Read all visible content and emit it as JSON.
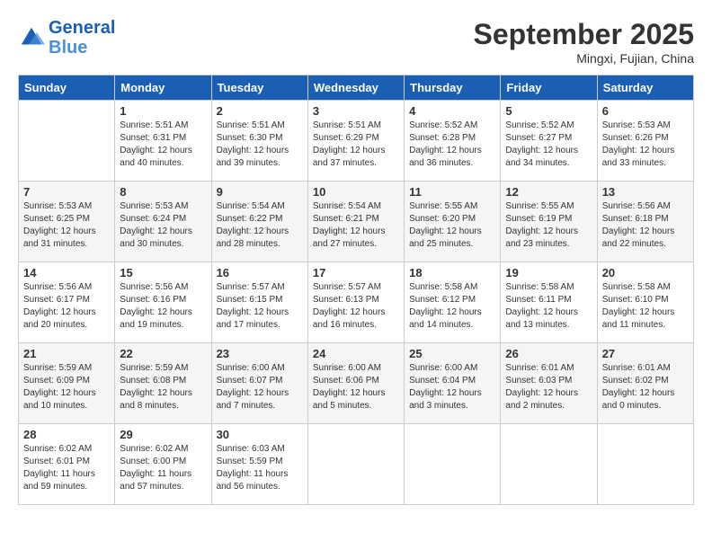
{
  "header": {
    "logo_line1": "General",
    "logo_line2": "Blue",
    "month": "September 2025",
    "location": "Mingxi, Fujian, China"
  },
  "weekdays": [
    "Sunday",
    "Monday",
    "Tuesday",
    "Wednesday",
    "Thursday",
    "Friday",
    "Saturday"
  ],
  "weeks": [
    [
      {
        "day": "",
        "info": ""
      },
      {
        "day": "1",
        "info": "Sunrise: 5:51 AM\nSunset: 6:31 PM\nDaylight: 12 hours\nand 40 minutes."
      },
      {
        "day": "2",
        "info": "Sunrise: 5:51 AM\nSunset: 6:30 PM\nDaylight: 12 hours\nand 39 minutes."
      },
      {
        "day": "3",
        "info": "Sunrise: 5:51 AM\nSunset: 6:29 PM\nDaylight: 12 hours\nand 37 minutes."
      },
      {
        "day": "4",
        "info": "Sunrise: 5:52 AM\nSunset: 6:28 PM\nDaylight: 12 hours\nand 36 minutes."
      },
      {
        "day": "5",
        "info": "Sunrise: 5:52 AM\nSunset: 6:27 PM\nDaylight: 12 hours\nand 34 minutes."
      },
      {
        "day": "6",
        "info": "Sunrise: 5:53 AM\nSunset: 6:26 PM\nDaylight: 12 hours\nand 33 minutes."
      }
    ],
    [
      {
        "day": "7",
        "info": "Sunrise: 5:53 AM\nSunset: 6:25 PM\nDaylight: 12 hours\nand 31 minutes."
      },
      {
        "day": "8",
        "info": "Sunrise: 5:53 AM\nSunset: 6:24 PM\nDaylight: 12 hours\nand 30 minutes."
      },
      {
        "day": "9",
        "info": "Sunrise: 5:54 AM\nSunset: 6:22 PM\nDaylight: 12 hours\nand 28 minutes."
      },
      {
        "day": "10",
        "info": "Sunrise: 5:54 AM\nSunset: 6:21 PM\nDaylight: 12 hours\nand 27 minutes."
      },
      {
        "day": "11",
        "info": "Sunrise: 5:55 AM\nSunset: 6:20 PM\nDaylight: 12 hours\nand 25 minutes."
      },
      {
        "day": "12",
        "info": "Sunrise: 5:55 AM\nSunset: 6:19 PM\nDaylight: 12 hours\nand 23 minutes."
      },
      {
        "day": "13",
        "info": "Sunrise: 5:56 AM\nSunset: 6:18 PM\nDaylight: 12 hours\nand 22 minutes."
      }
    ],
    [
      {
        "day": "14",
        "info": "Sunrise: 5:56 AM\nSunset: 6:17 PM\nDaylight: 12 hours\nand 20 minutes."
      },
      {
        "day": "15",
        "info": "Sunrise: 5:56 AM\nSunset: 6:16 PM\nDaylight: 12 hours\nand 19 minutes."
      },
      {
        "day": "16",
        "info": "Sunrise: 5:57 AM\nSunset: 6:15 PM\nDaylight: 12 hours\nand 17 minutes."
      },
      {
        "day": "17",
        "info": "Sunrise: 5:57 AM\nSunset: 6:13 PM\nDaylight: 12 hours\nand 16 minutes."
      },
      {
        "day": "18",
        "info": "Sunrise: 5:58 AM\nSunset: 6:12 PM\nDaylight: 12 hours\nand 14 minutes."
      },
      {
        "day": "19",
        "info": "Sunrise: 5:58 AM\nSunset: 6:11 PM\nDaylight: 12 hours\nand 13 minutes."
      },
      {
        "day": "20",
        "info": "Sunrise: 5:58 AM\nSunset: 6:10 PM\nDaylight: 12 hours\nand 11 minutes."
      }
    ],
    [
      {
        "day": "21",
        "info": "Sunrise: 5:59 AM\nSunset: 6:09 PM\nDaylight: 12 hours\nand 10 minutes."
      },
      {
        "day": "22",
        "info": "Sunrise: 5:59 AM\nSunset: 6:08 PM\nDaylight: 12 hours\nand 8 minutes."
      },
      {
        "day": "23",
        "info": "Sunrise: 6:00 AM\nSunset: 6:07 PM\nDaylight: 12 hours\nand 7 minutes."
      },
      {
        "day": "24",
        "info": "Sunrise: 6:00 AM\nSunset: 6:06 PM\nDaylight: 12 hours\nand 5 minutes."
      },
      {
        "day": "25",
        "info": "Sunrise: 6:00 AM\nSunset: 6:04 PM\nDaylight: 12 hours\nand 3 minutes."
      },
      {
        "day": "26",
        "info": "Sunrise: 6:01 AM\nSunset: 6:03 PM\nDaylight: 12 hours\nand 2 minutes."
      },
      {
        "day": "27",
        "info": "Sunrise: 6:01 AM\nSunset: 6:02 PM\nDaylight: 12 hours\nand 0 minutes."
      }
    ],
    [
      {
        "day": "28",
        "info": "Sunrise: 6:02 AM\nSunset: 6:01 PM\nDaylight: 11 hours\nand 59 minutes."
      },
      {
        "day": "29",
        "info": "Sunrise: 6:02 AM\nSunset: 6:00 PM\nDaylight: 11 hours\nand 57 minutes."
      },
      {
        "day": "30",
        "info": "Sunrise: 6:03 AM\nSunset: 5:59 PM\nDaylight: 11 hours\nand 56 minutes."
      },
      {
        "day": "",
        "info": ""
      },
      {
        "day": "",
        "info": ""
      },
      {
        "day": "",
        "info": ""
      },
      {
        "day": "",
        "info": ""
      }
    ]
  ]
}
